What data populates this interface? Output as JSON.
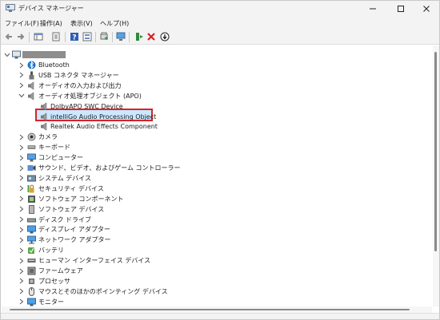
{
  "window": {
    "title": "デバイス マネージャー"
  },
  "menu": [
    "ファイル(F)",
    "操作(A)",
    "表示(V)",
    "ヘルプ(H)"
  ],
  "toolbar": {
    "buttons": [
      "back-icon",
      "forward-icon",
      "console-tree-icon",
      "properties-icon",
      "help-icon",
      "scan-hardware-icon",
      "monitor-icon",
      "enable-device-icon",
      "uninstall-icon",
      "update-driver-icon"
    ]
  },
  "tree": {
    "root_label": "",
    "items": [
      {
        "label": "Bluetooth",
        "icon": "bluetooth-icon"
      },
      {
        "label": "USB コネクタ マネージャー",
        "icon": "usb-icon"
      },
      {
        "label": "オーディオの入力および出力",
        "icon": "speaker-icon"
      },
      {
        "label": "オーディオ処理オブジェクト (APO)",
        "icon": "speaker-icon",
        "expanded": true,
        "children": [
          {
            "label": "DolbyAPO SWC Device",
            "icon": "speaker-icon"
          },
          {
            "label": "intelliGo Audio Processing Object",
            "icon": "speaker-icon",
            "selected": true
          },
          {
            "label": "Realtek Audio Effects Component",
            "icon": "speaker-icon"
          }
        ]
      },
      {
        "label": "カメラ",
        "icon": "camera-icon"
      },
      {
        "label": "キーボード",
        "icon": "keyboard-icon"
      },
      {
        "label": "コンピューター",
        "icon": "computer-icon"
      },
      {
        "label": "サウンド、ビデオ、およびゲーム コントローラー",
        "icon": "sound-icon"
      },
      {
        "label": "システム デバイス",
        "icon": "system-icon"
      },
      {
        "label": "セキュリティ デバイス",
        "icon": "security-icon"
      },
      {
        "label": "ソフトウェア コンポーネント",
        "icon": "software-component-icon"
      },
      {
        "label": "ソフトウェア デバイス",
        "icon": "software-device-icon"
      },
      {
        "label": "ディスク ドライブ",
        "icon": "disk-icon"
      },
      {
        "label": "ディスプレイ アダプター",
        "icon": "display-icon"
      },
      {
        "label": "ネットワーク アダプター",
        "icon": "network-icon"
      },
      {
        "label": "バッテリ",
        "icon": "battery-icon"
      },
      {
        "label": "ヒューマン インターフェイス デバイス",
        "icon": "hid-icon"
      },
      {
        "label": "ファームウェア",
        "icon": "firmware-icon"
      },
      {
        "label": "プロセッサ",
        "icon": "processor-icon"
      },
      {
        "label": "マウスとそのほかのポインティング デバイス",
        "icon": "mouse-icon"
      },
      {
        "label": "モニター",
        "icon": "monitor-icon"
      }
    ]
  },
  "colors": {
    "selection": "#cce8ff",
    "highlight_border": "#d8232a"
  }
}
